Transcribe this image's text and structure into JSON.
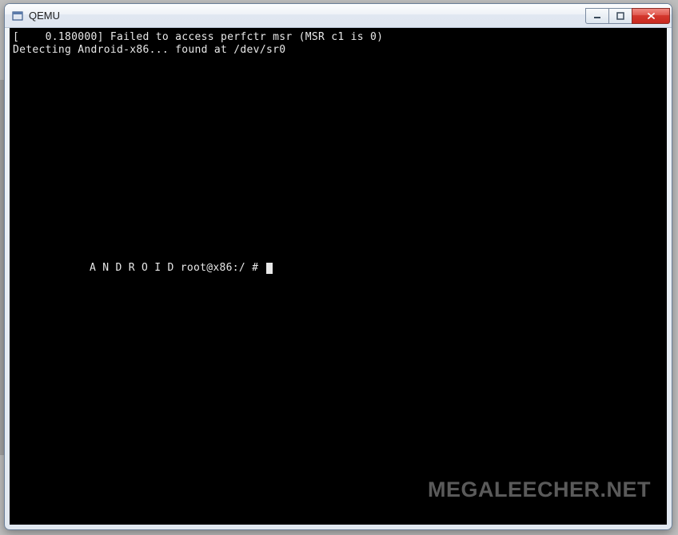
{
  "window": {
    "title": "QEMU"
  },
  "terminal": {
    "line1": "[    0.180000] Failed to access perfctr msr (MSR c1 is 0)",
    "line2": "Detecting Android-x86... found at /dev/sr0",
    "prompt": "A N D R O I D root@x86:/ # "
  },
  "watermark": {
    "text": "MEGALEECHER.NET"
  }
}
